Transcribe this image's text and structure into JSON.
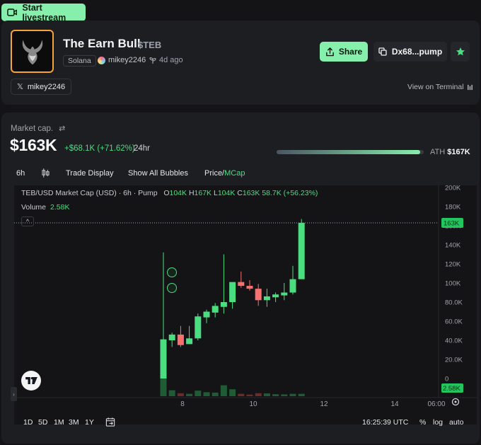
{
  "livestream": {
    "label": "Start livestream"
  },
  "token": {
    "name": "The Earn Bull",
    "symbol": "$TEB",
    "chain": "Solana",
    "creator": "mikey2246",
    "age": "4d ago",
    "twitter": "mikey2246",
    "share_label": "Share",
    "contract_short": "Dx68...pump",
    "terminal_label": "View on Terminal"
  },
  "market": {
    "label": "Market cap.",
    "value": "$163K",
    "change": "+$68.1K (+71.62%)",
    "period": "24hr",
    "ath_label": "ATH",
    "ath_value": "$167K",
    "ath_progress": 0.976
  },
  "toolbar": {
    "interval": "6h",
    "trade_display": "Trade Display",
    "show_bubbles": "Show All Bubbles",
    "price_label": "Price/",
    "mcap_label": "MCap"
  },
  "chart_header": {
    "title": "TEB/USD Market Cap (USD) · 6h · Pump",
    "o_label": "O",
    "o": "104K",
    "h_label": "H",
    "h": "167K",
    "l_label": "L",
    "l": "104K",
    "c_label": "C",
    "c": "163K",
    "change": "58.7K (+56.23%)",
    "volume_label": "Volume",
    "volume_value": "2.58K"
  },
  "chart_data": {
    "type": "candlestick",
    "y_ticks": [
      "200K",
      "180K",
      "160K",
      "140K",
      "120K",
      "100K",
      "80.0K",
      "60.0K",
      "40.0K",
      "20.0K",
      "0"
    ],
    "ylim": [
      0,
      200000
    ],
    "x_ticks": [
      "8",
      "10",
      "12",
      "14",
      "06:00"
    ],
    "current_price_label": "163K",
    "current_volume_label": "2.58K",
    "colors": {
      "up": "#4ade80",
      "down": "#f87171",
      "up_vol": "#1f5c36",
      "down_vol": "#6b2b2b"
    },
    "candles": [
      {
        "o": 0,
        "h": 132000,
        "l": 0,
        "c": 41000,
        "v": 1.0
      },
      {
        "o": 40000,
        "h": 48000,
        "l": 33000,
        "c": 46000,
        "v": 0.3
      },
      {
        "o": 46000,
        "h": 55000,
        "l": 33000,
        "c": 35000,
        "v": 0.15
      },
      {
        "o": 36000,
        "h": 55000,
        "l": 36000,
        "c": 42000,
        "v": 0.12
      },
      {
        "o": 42000,
        "h": 68000,
        "l": 40000,
        "c": 65000,
        "v": 0.28
      },
      {
        "o": 64000,
        "h": 72000,
        "l": 58000,
        "c": 70000,
        "v": 0.2
      },
      {
        "o": 69000,
        "h": 79000,
        "l": 64000,
        "c": 76000,
        "v": 0.18
      },
      {
        "o": 75000,
        "h": 130000,
        "l": 68000,
        "c": 80000,
        "v": 0.55
      },
      {
        "o": 80000,
        "h": 100000,
        "l": 73000,
        "c": 101000,
        "v": 0.35
      },
      {
        "o": 101000,
        "h": 112000,
        "l": 95000,
        "c": 97000,
        "v": 0.12
      },
      {
        "o": 97000,
        "h": 103000,
        "l": 92000,
        "c": 94000,
        "v": 0.08
      },
      {
        "o": 94000,
        "h": 99000,
        "l": 76000,
        "c": 82000,
        "v": 0.15
      },
      {
        "o": 82000,
        "h": 94000,
        "l": 75000,
        "c": 86000,
        "v": 0.14
      },
      {
        "o": 85000,
        "h": 90000,
        "l": 80000,
        "c": 88000,
        "v": 0.1
      },
      {
        "o": 87000,
        "h": 100000,
        "l": 82000,
        "c": 90000,
        "v": 0.09
      },
      {
        "o": 90000,
        "h": 118000,
        "l": 88000,
        "c": 104000,
        "v": 0.12
      },
      {
        "o": 104000,
        "h": 167000,
        "l": 104000,
        "c": 163000,
        "v": 0.12
      }
    ]
  },
  "bottom": {
    "ranges": [
      "1D",
      "5D",
      "1M",
      "3M",
      "1Y"
    ],
    "time": "16:25:39 UTC",
    "percent": "%",
    "log": "log",
    "auto": "auto"
  }
}
